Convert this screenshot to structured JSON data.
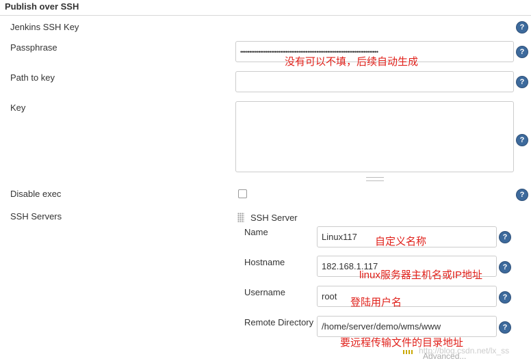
{
  "section": {
    "title": "Publish over SSH"
  },
  "fields": {
    "jenkins_ssh_key_label": "Jenkins SSH Key",
    "passphrase_label": "Passphrase",
    "passphrase_value": "••••••••••••••••••••••••••••••••••••••••••••••••••••••••••••••••••••••••••••",
    "path_to_key_label": "Path to key",
    "key_label": "Key",
    "disable_exec_label": "Disable exec",
    "ssh_servers_label": "SSH Servers"
  },
  "ssh_server": {
    "header": "SSH Server",
    "name_label": "Name",
    "name_value": "Linux117",
    "hostname_label": "Hostname",
    "hostname_value": "182.168.1.117",
    "username_label": "Username",
    "username_value": "root",
    "remote_dir_label": "Remote Directory",
    "remote_dir_value": "/home/server/demo/wms/www",
    "advanced_label": "Advanced..."
  },
  "annotations": {
    "passphrase_note": "没有可以不填，后续自动生成",
    "name_note": "自定义名称",
    "hostname_note": "linux服务器主机名或IP地址",
    "username_note": "登陆用户名",
    "remote_dir_note": "要远程传输文件的目录地址"
  },
  "help_glyph": "?",
  "watermark": "http://blog.csdn.net/lx_ss",
  "colors": {
    "help_icon": "#3d6a9c",
    "annotation": "#e0201a"
  }
}
